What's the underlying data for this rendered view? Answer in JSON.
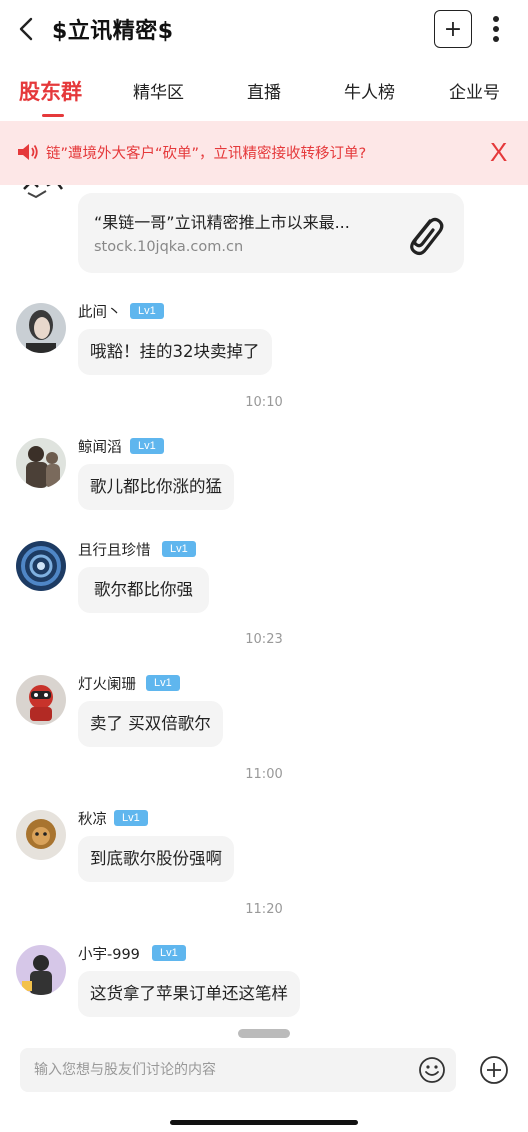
{
  "header": {
    "title": "$立讯精密$",
    "add_label": "+"
  },
  "tabs": [
    {
      "label": "股东群",
      "active": true
    },
    {
      "label": "精华区"
    },
    {
      "label": "直播"
    },
    {
      "label": "牛人榜"
    },
    {
      "label": "企业号"
    }
  ],
  "notice": {
    "text": "链”遭境外大客户“砍单”，立讯精密接收转移订单?",
    "close": "X"
  },
  "link_card": {
    "title": "“果链一哥”立讯精密推上市以来最...",
    "url": "stock.10jqka.com.cn"
  },
  "messages": [
    {
      "user": "此间丶",
      "level": "Lv1",
      "text": "哦豁！挂的32块卖掉了"
    },
    {
      "user": "鲸闻滔",
      "level": "Lv1",
      "text": "歌儿都比你涨的猛"
    },
    {
      "user": "且行且珍惜",
      "level": "Lv1",
      "text": "歌尔都比你强"
    },
    {
      "user": "灯火阑珊",
      "level": "Lv1",
      "text": "卖了 买双倍歌尔"
    },
    {
      "user": "秋凉",
      "level": "Lv1",
      "text": "到底歌尔股份强啊"
    },
    {
      "user": "小宇-999",
      "level": "Lv1",
      "text": "这货拿了苹果订单还这笔样"
    }
  ],
  "times": [
    "10:10",
    "10:23",
    "11:00",
    "11:20"
  ],
  "input": {
    "placeholder": "输入您想与股友们讨论的内容"
  },
  "colors": {
    "accent": "#e5393b",
    "notice_bg": "#fde7e7",
    "level_badge": "#5fb6ee",
    "bubble_bg": "#f4f4f4"
  },
  "icons": [
    "back-icon",
    "plus-icon",
    "more-vertical-icon",
    "speaker-icon",
    "close-icon",
    "paperclip-icon",
    "emoji-icon",
    "add-circle-icon"
  ]
}
